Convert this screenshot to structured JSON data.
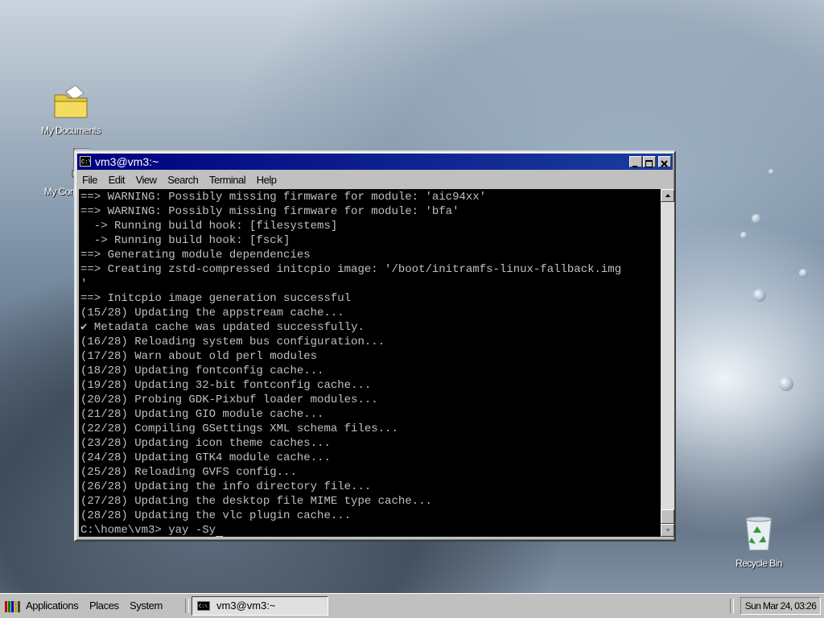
{
  "desktop": {
    "icons": [
      {
        "label": "My Documents",
        "icon": "folder-documents-icon"
      },
      {
        "label": "My Computer",
        "icon": "computer-icon"
      },
      {
        "label": "Recycle Bin",
        "icon": "recycle-bin-icon"
      }
    ]
  },
  "window": {
    "title": "vm3@vm3:~",
    "menu": [
      "File",
      "Edit",
      "View",
      "Search",
      "Terminal",
      "Help"
    ],
    "controls": [
      "minimize",
      "maximize",
      "close"
    ]
  },
  "terminal": {
    "lines": [
      "==> WARNING: Possibly missing firmware for module: 'aic94xx'",
      "==> WARNING: Possibly missing firmware for module: 'bfa'",
      "  -> Running build hook: [filesystems]",
      "  -> Running build hook: [fsck]",
      "==> Generating module dependencies",
      "==> Creating zstd-compressed initcpio image: '/boot/initramfs-linux-fallback.img",
      "'",
      "==> Initcpio image generation successful",
      "(15/28) Updating the appstream cache...",
      "✔ Metadata cache was updated successfully.",
      "(16/28) Reloading system bus configuration...",
      "(17/28) Warn about old perl modules",
      "(18/28) Updating fontconfig cache...",
      "(19/28) Updating 32-bit fontconfig cache...",
      "(20/28) Probing GDK-Pixbuf loader modules...",
      "(21/28) Updating GIO module cache...",
      "(22/28) Compiling GSettings XML schema files...",
      "(23/28) Updating icon theme caches...",
      "(24/28) Updating GTK4 module cache...",
      "(25/28) Reloading GVFS config...",
      "(26/28) Updating the info directory file...",
      "(27/28) Updating the desktop file MIME type cache...",
      "(28/28) Updating the vlc plugin cache..."
    ],
    "prompt": "C:\\home\\vm3> ",
    "input": "yay -Sy"
  },
  "taskbar": {
    "applications": "Applications",
    "places": "Places",
    "system": "System",
    "task_label": "vm3@vm3:~",
    "clock": "Sun Mar 24, 03:26"
  }
}
